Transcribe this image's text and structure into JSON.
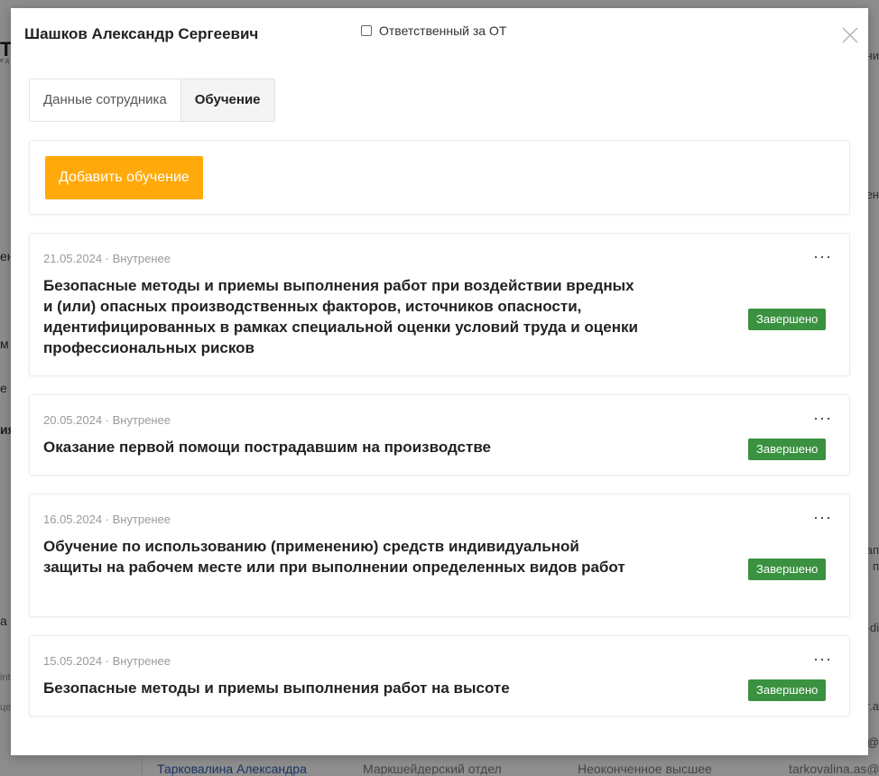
{
  "background": {
    "left_fragments": [
      "Т",
      "е д",
      "ен",
      "м",
      "е",
      "ия",
      "а",
      "int",
      "це"
    ],
    "right_fragments": [
      "ни",
      "ен",
      "ап",
      "п",
      "-di",
      "r.a",
      "as@"
    ],
    "table_row": [
      "Тарковалина Александра",
      "Маркшейдерский отдел",
      "Неоконченное высшее",
      "tarkovalina.as@"
    ]
  },
  "modal": {
    "title": "Шашков Александр Сергеевич",
    "responsible_label": "Ответственный за ОТ",
    "close_icon": "close-icon",
    "tabs": [
      {
        "label": "Данные сотрудника",
        "active": false
      },
      {
        "label": "Обучение",
        "active": true
      }
    ],
    "add_button_label": "Добавить обучение",
    "more_label": "···",
    "courses": [
      {
        "meta": "21.05.2024 · Внутренее",
        "title": "Безопасные методы и приемы выполнения работ при воздействии вредных и (или) опасных производственных факторов, источников опасности, идентифицированных в рамках специальной оценки условий труда и оценки профессиональных рисков",
        "status": "Завершено"
      },
      {
        "meta": "20.05.2024 · Внутренее",
        "title": "Оказание первой помощи пострадавшим на производстве",
        "status": "Завершено"
      },
      {
        "meta": "16.05.2024 · Внутренее",
        "title": "Обучение по использованию (применению) средств индивидуальной защиты на рабочем месте или при выполнении определенных видов работ",
        "status": "Завершено"
      },
      {
        "meta": "15.05.2024 · Внутренее",
        "title": "Безопасные методы и приемы выполнения работ на высоте",
        "status": "Завершено"
      }
    ]
  },
  "colors": {
    "accent": "#ffa90b",
    "status_done": "#3a9140"
  }
}
